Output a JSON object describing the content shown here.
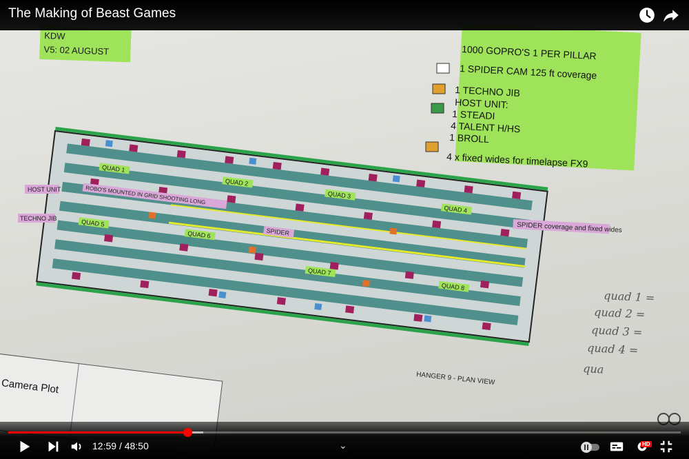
{
  "video": {
    "title": "The Making of Beast Games",
    "current_time": "12:59",
    "duration": "48:50",
    "time_separator": "/",
    "progress_fraction": 0.2659,
    "buffer_fraction": 0.29
  },
  "frame": {
    "plan_header": [
      "KDW",
      "V5: 02 AUGUST"
    ],
    "legend": [
      "1000 GOPRO'S 1 PER PILLAR",
      "1 SPIDER CAM 125 ft coverage",
      "1 TECHNO JIB",
      "HOST UNIT:",
      "1 STEADI",
      "4 TALENT H/HS",
      "1 BROLL",
      "4 x fixed wides for timelapse FX9"
    ],
    "quad_labels": [
      "QUAD 1",
      "QUAD 2",
      "QUAD 3",
      "QUAD 4",
      "QUAD 5",
      "QUAD 6",
      "QUAD 7",
      "QUAD 8"
    ],
    "tags": [
      "HOST UNIT",
      "TECHNO JIB",
      "SPIDER"
    ],
    "notes": [
      "ROBO'S MOUNTED IN GRID SHOOTING LONG",
      "SPIDER coverage and fixed wides"
    ],
    "plan_caption": "HANGER 9 - PLAN VIEW",
    "camera_plot": "Camera Plot",
    "handwritten": [
      "quad 1 =",
      "quad 2 =",
      "quad 3 =",
      "quad 4 =",
      "qua"
    ]
  },
  "controls": {
    "play_icon": "play-icon",
    "next_icon": "next-icon",
    "volume_icon": "volume-icon",
    "autoplay_icon": "autoplay-toggle-icon",
    "subtitles_icon": "subtitles-icon",
    "settings_icon": "settings-icon",
    "settings_badge": "HD",
    "exit_fullscreen_icon": "exit-fullscreen-icon"
  },
  "colors": {
    "progress_played": "#ff0000",
    "legend_green": "#9fe35a",
    "camera_magenta": "#a0205e",
    "floor_teal": "#4f8f8c"
  }
}
